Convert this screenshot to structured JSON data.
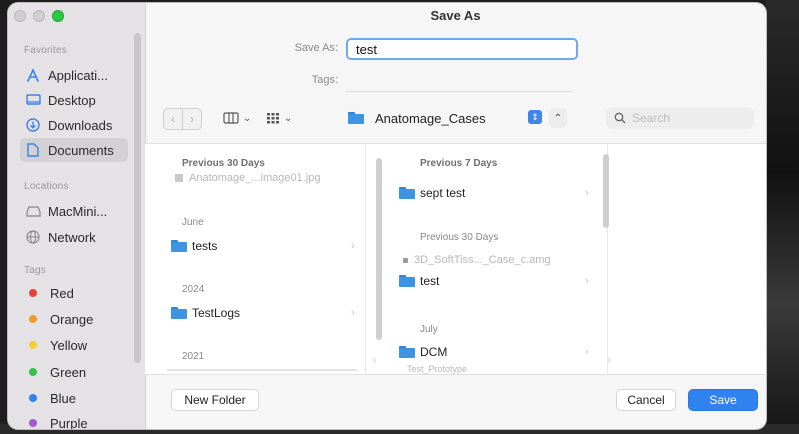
{
  "window": {
    "title": "Save As"
  },
  "form": {
    "save_as_label": "Save As:",
    "save_as_value": "test",
    "tags_label": "Tags:",
    "tags_value": ""
  },
  "sidebar": {
    "favorites_label": "Favorites",
    "favorites": [
      {
        "label": "Applicati...",
        "icon": "applications-icon"
      },
      {
        "label": "Desktop",
        "icon": "desktop-icon"
      },
      {
        "label": "Downloads",
        "icon": "downloads-icon"
      },
      {
        "label": "Documents",
        "icon": "documents-icon",
        "selected": true
      }
    ],
    "locations_label": "Locations",
    "locations": [
      {
        "label": "MacMini...",
        "icon": "drive-icon"
      },
      {
        "label": "Network",
        "icon": "network-icon"
      }
    ],
    "tags_label": "Tags",
    "tags": [
      {
        "label": "Red",
        "color": "#e8413a"
      },
      {
        "label": "Orange",
        "color": "#f29a2e"
      },
      {
        "label": "Yellow",
        "color": "#f3cf2f"
      },
      {
        "label": "Green",
        "color": "#35c14b"
      },
      {
        "label": "Blue",
        "color": "#2f82f0"
      },
      {
        "label": "Purple",
        "color": "#a25ad6"
      }
    ]
  },
  "toolbar": {
    "location": "Anatomage_Cases",
    "search_placeholder": "Search"
  },
  "columns": {
    "col1": {
      "group_previous_30": "Previous 30 Days",
      "dim_file": "Anatomage_...image01.jpg",
      "group_june": "June",
      "folder_tests": "tests",
      "group_2024": "2024",
      "folder_testlogs": "TestLogs",
      "group_2021": "2021"
    },
    "col2": {
      "group_previous_7": "Previous 7 Days",
      "folder_sept_test": "sept test",
      "group_previous_30": "Previous 30 Days",
      "dim_file": "3D_SoftTiss..._Case_c.amg",
      "folder_test": "test",
      "group_july": "July",
      "folder_dcm": "DCM",
      "dim_cut": "Test_Prototype"
    }
  },
  "footer": {
    "new_folder": "New Folder",
    "cancel": "Cancel",
    "save": "Save"
  },
  "colors": {
    "accent": "#2f82f0",
    "folder": "#3b95e4"
  }
}
